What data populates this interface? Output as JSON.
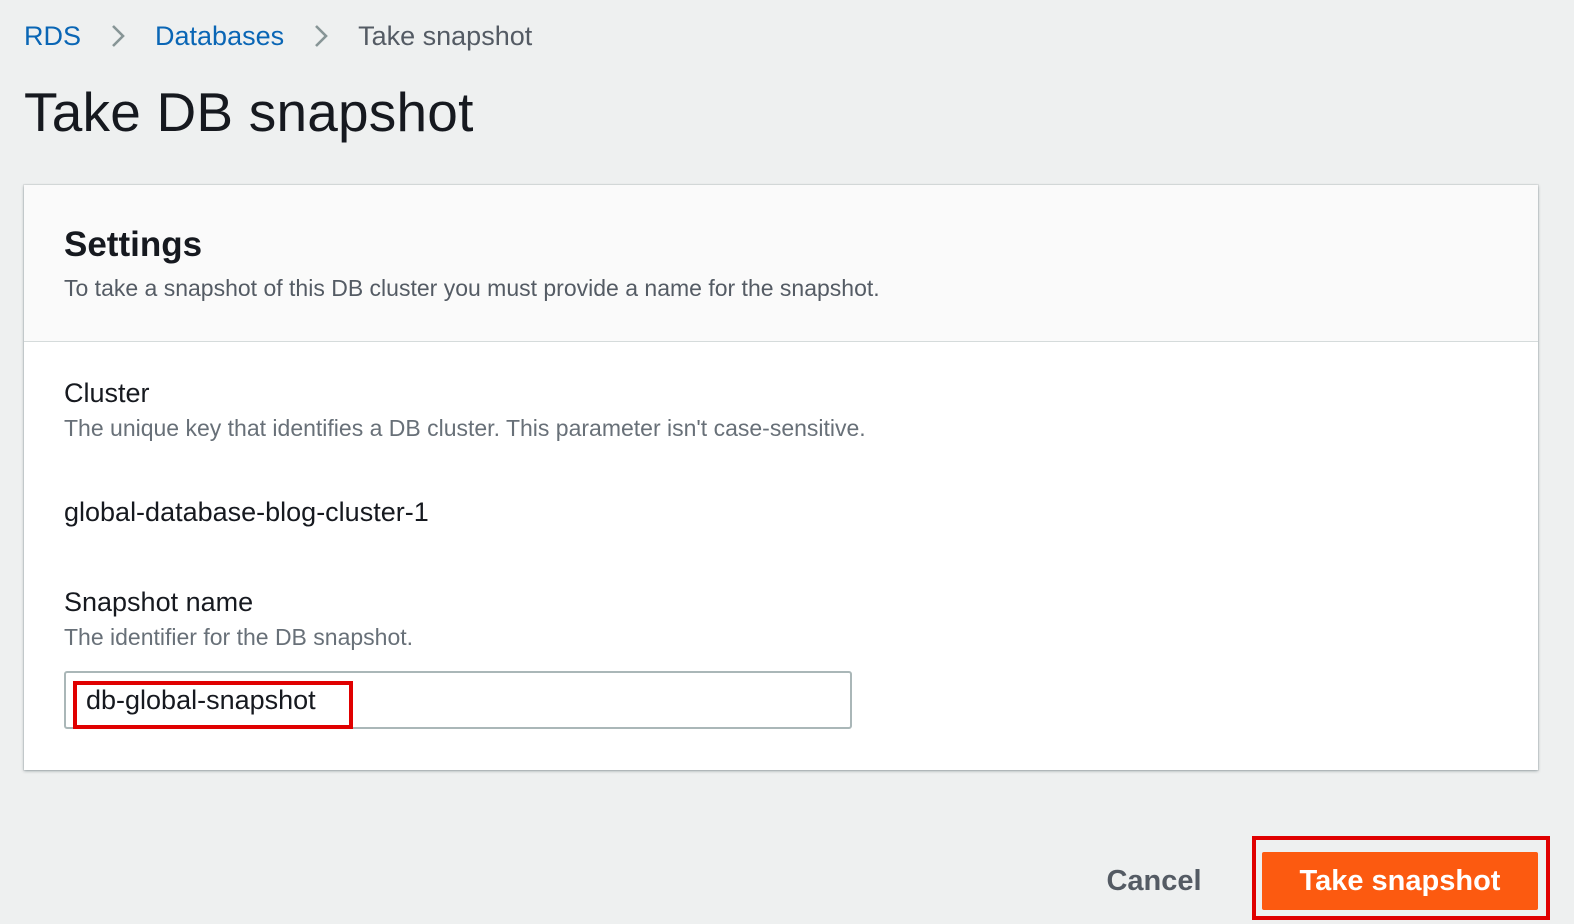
{
  "breadcrumb": {
    "items": [
      {
        "label": "RDS"
      },
      {
        "label": "Databases"
      },
      {
        "label": "Take snapshot"
      }
    ]
  },
  "page": {
    "title": "Take DB snapshot"
  },
  "settings": {
    "heading": "Settings",
    "description": "To take a snapshot of this DB cluster you must provide a name for the snapshot.",
    "cluster": {
      "label": "Cluster",
      "description": "The unique key that identifies a DB cluster. This parameter isn't case-sensitive.",
      "value": "global-database-blog-cluster-1"
    },
    "snapshot_name": {
      "label": "Snapshot name",
      "description": "The identifier for the DB snapshot.",
      "value": "db-global-snapshot"
    }
  },
  "actions": {
    "cancel_label": "Cancel",
    "submit_label": "Take snapshot"
  },
  "colors": {
    "link": "#0a66b5",
    "primary": "#fc5a10",
    "highlight": "#e00000",
    "background": "#eef0f0"
  },
  "icons": {
    "breadcrumb_separator": "chevron-right-icon"
  }
}
